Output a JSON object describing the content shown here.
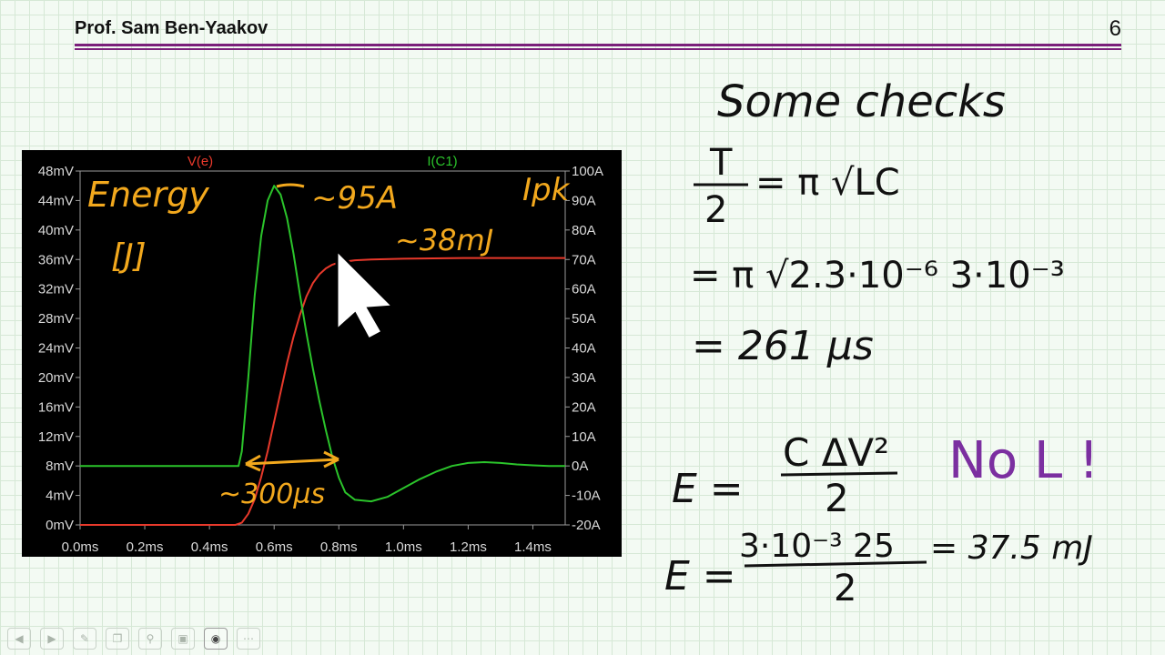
{
  "header": {
    "presenter": "Prof. Sam Ben-Yaakov",
    "page_number": "6"
  },
  "chart_data": {
    "type": "line",
    "x_tick_labels": [
      "0.0ms",
      "0.2ms",
      "0.4ms",
      "0.6ms",
      "0.8ms",
      "1.0ms",
      "1.2ms",
      "1.4ms"
    ],
    "x_ticks_ms": [
      0,
      0.2,
      0.4,
      0.6,
      0.8,
      1.0,
      1.2,
      1.4
    ],
    "xlim_ms": [
      0,
      1.5
    ],
    "y_left_tick_labels": [
      "0mV",
      "4mV",
      "8mV",
      "12mV",
      "16mV",
      "20mV",
      "24mV",
      "28mV",
      "32mV",
      "36mV",
      "40mV",
      "44mV",
      "48mV"
    ],
    "y_left_ticks": [
      0,
      4,
      8,
      12,
      16,
      20,
      24,
      28,
      32,
      36,
      40,
      44,
      48
    ],
    "ylim_left_mV": [
      0,
      48
    ],
    "y_right_tick_labels": [
      "-20A",
      "-10A",
      "0A",
      "10A",
      "20A",
      "30A",
      "40A",
      "50A",
      "60A",
      "70A",
      "80A",
      "90A",
      "100A"
    ],
    "y_right_ticks": [
      -20,
      -10,
      0,
      10,
      20,
      30,
      40,
      50,
      60,
      70,
      80,
      90,
      100
    ],
    "ylim_right_A": [
      -20,
      100
    ],
    "grid": false,
    "series": [
      {
        "name": "V(e)",
        "axis": "left",
        "color": "#e8392b",
        "x_ms": [
          0,
          0.48,
          0.5,
          0.52,
          0.54,
          0.56,
          0.58,
          0.6,
          0.62,
          0.64,
          0.66,
          0.68,
          0.7,
          0.72,
          0.74,
          0.76,
          0.78,
          0.8,
          0.85,
          0.9,
          1.0,
          1.2,
          1.5
        ],
        "y_mV": [
          0,
          0,
          0.3,
          1.5,
          3.5,
          6.5,
          10,
          14,
          18,
          22,
          25.5,
          28.5,
          31,
          32.8,
          34,
          34.8,
          35.3,
          35.6,
          35.9,
          36.0,
          36.1,
          36.2,
          36.2
        ]
      },
      {
        "name": "I(C1)",
        "axis": "right",
        "color": "#2bc42b",
        "x_ms": [
          0,
          0.49,
          0.5,
          0.52,
          0.54,
          0.56,
          0.58,
          0.6,
          0.62,
          0.64,
          0.66,
          0.68,
          0.7,
          0.72,
          0.74,
          0.76,
          0.78,
          0.8,
          0.82,
          0.85,
          0.9,
          0.95,
          1.0,
          1.05,
          1.1,
          1.15,
          1.2,
          1.25,
          1.3,
          1.35,
          1.4,
          1.45,
          1.5
        ],
        "y_A": [
          0,
          0,
          5,
          30,
          58,
          78,
          90,
          95,
          92,
          84,
          72,
          58,
          45,
          33,
          22,
          12,
          3,
          -4,
          -9,
          -11.5,
          -12,
          -10.5,
          -7.5,
          -4.5,
          -2,
          0,
          1,
          1.3,
          1,
          0.5,
          0.2,
          0,
          0
        ]
      }
    ]
  },
  "annotations": {
    "energy": "Energy",
    "energy_unit": "[J]",
    "peak_current": "~95A",
    "ipk": "Ipk",
    "energy_final": "~38mJ",
    "width": "~300µs"
  },
  "notes": {
    "title": "Some checks",
    "period_lhs_num": "T",
    "period_lhs_den": "2",
    "period_rhs": "= π √LC",
    "line2": "= π √2.3·10⁻⁶ 3·10⁻³",
    "line3": "= 261 µs",
    "energy_lhs": "E =",
    "energy_num": "C ΔV²",
    "energy_den": "2",
    "no_l": "No L !",
    "calc_lhs": "E =",
    "calc_num": "3·10⁻³ 25",
    "calc_den": "2",
    "calc_result": "= 37.5 mJ"
  },
  "toolbar": {
    "icons": [
      "back-icon",
      "forward-icon",
      "pen-icon",
      "copy-icon",
      "zoom-icon",
      "fit-icon",
      "record-icon",
      "more-icon"
    ]
  }
}
